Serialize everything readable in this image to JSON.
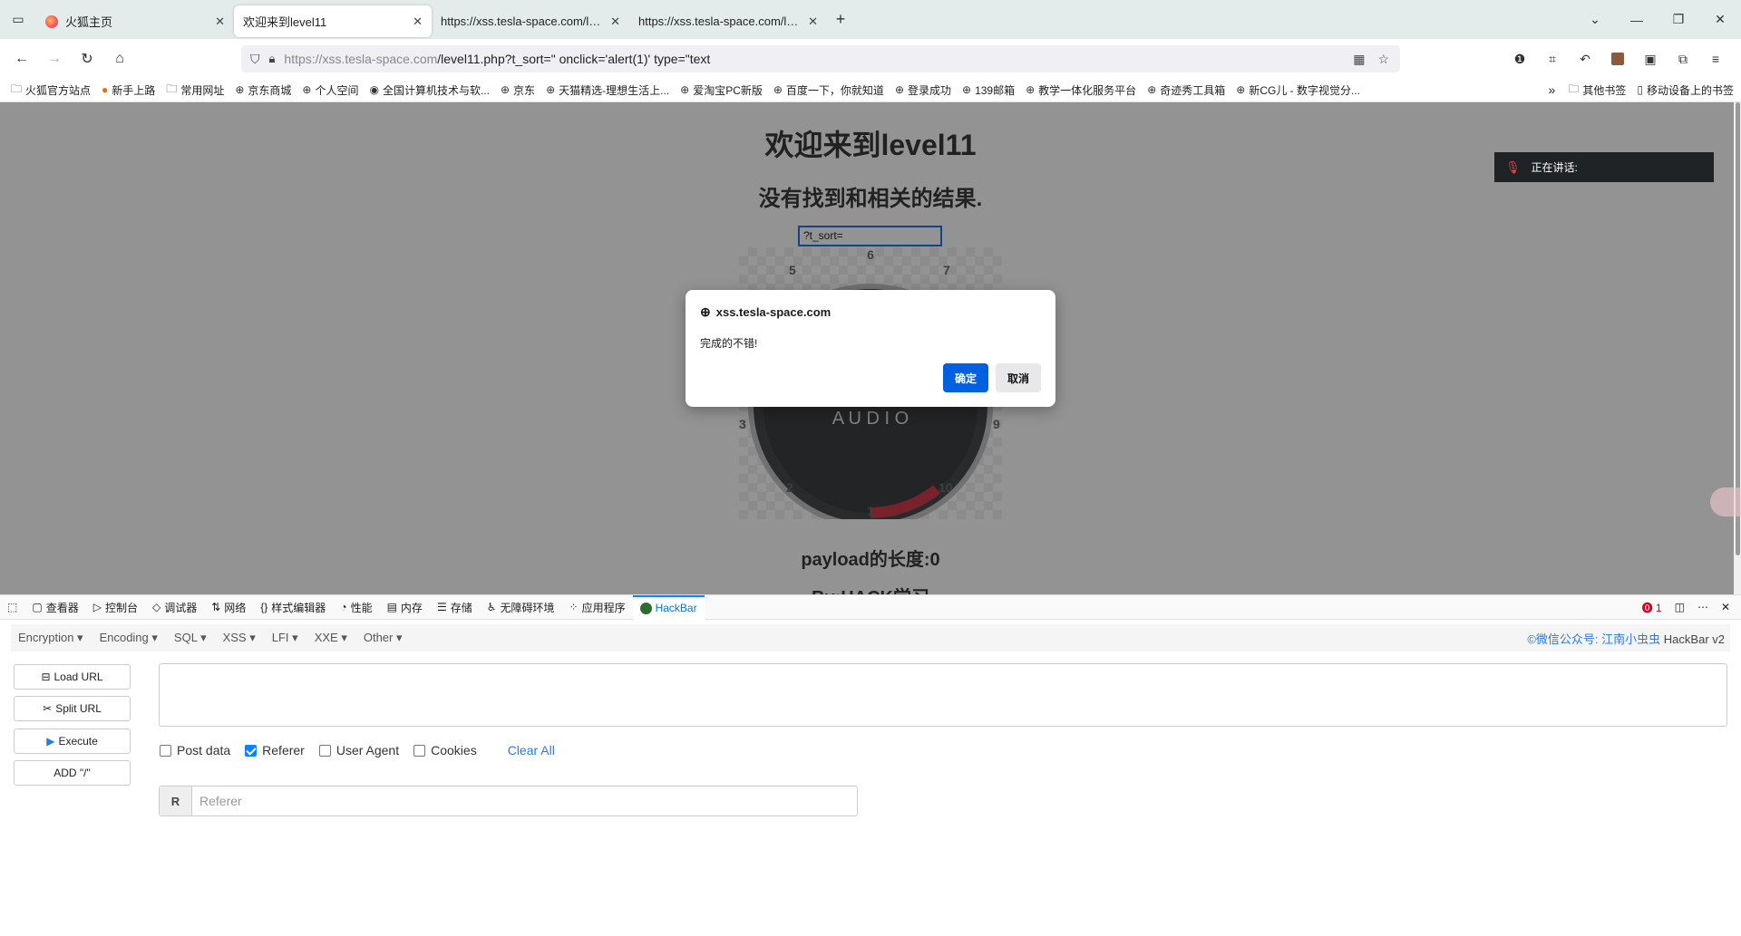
{
  "browser": {
    "tabs": [
      {
        "title": "火狐主页",
        "active": false
      },
      {
        "title": "欢迎来到level11",
        "active": true
      },
      {
        "title": "https://xss.tesla-space.com/level",
        "active": false
      },
      {
        "title": "https://xss.tesla-space.com/level",
        "active": false
      }
    ],
    "url_host": "https://xss.tesla-space.com",
    "url_path": "/level11.php?t_sort=\" onclick='alert(1)' type=\"text",
    "bookmarks": [
      "火狐官方站点",
      "新手上路",
      "常用网址",
      "京东商城",
      "个人空间",
      "全国计算机技术与软...",
      "京东",
      "天猫精选-理想生活上...",
      "爱淘宝PC新版",
      "百度一下，你就知道",
      "登录成功",
      "139邮箱",
      "教学一体化服务平台",
      "奇迹秀工具箱",
      "新CG儿 - 数字视觉分..."
    ],
    "other_bookmarks": "其他书签",
    "mobile_bookmarks": "移动设备上的书签"
  },
  "page": {
    "title": "欢迎来到level11",
    "result": "没有找到和相关的结果.",
    "input_value": "?t_sort=",
    "gauge_label": "A U D I O",
    "gauge_numbers": [
      "1",
      "2",
      "3",
      "5",
      "6",
      "7",
      "9",
      "10"
    ],
    "payload_length": "payload的长度:0",
    "footer": "By:HACK学习"
  },
  "speaking_widget": {
    "label": "正在讲话:"
  },
  "dialog": {
    "host": "xss.tesla-space.com",
    "message": "完成的不错!",
    "ok": "确定",
    "cancel": "取消"
  },
  "devtools": {
    "tabs": [
      "查看器",
      "控制台",
      "调试器",
      "网络",
      "样式编辑器",
      "性能",
      "内存",
      "存储",
      "无障碍环境",
      "应用程序",
      "HackBar"
    ],
    "active_tab": "HackBar",
    "error_count": "1"
  },
  "hackbar": {
    "menus": [
      "Encryption",
      "Encoding",
      "SQL",
      "XSS",
      "LFI",
      "XXE",
      "Other"
    ],
    "credit_prefix": "©微信公众号:",
    "credit_name": "江南小虫虫",
    "credit_suffix": "HackBar v2",
    "buttons": [
      "Load URL",
      "Split URL",
      "Execute",
      "ADD \"/\""
    ],
    "checkboxes": [
      {
        "label": "Post data",
        "checked": false
      },
      {
        "label": "Referer",
        "checked": true
      },
      {
        "label": "User Agent",
        "checked": false
      },
      {
        "label": "Cookies",
        "checked": false
      }
    ],
    "clear_all": "Clear All",
    "referer_tag": "R",
    "referer_placeholder": "Referer"
  }
}
